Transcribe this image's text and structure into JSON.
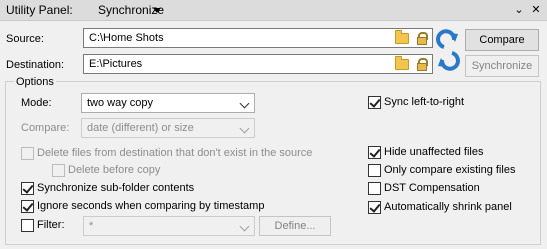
{
  "titlebar": {
    "title": "Utility Panel:",
    "selected_view": "Synchronize",
    "collapse_label": "⌄",
    "close_label": "✕"
  },
  "source": {
    "label": "Source:",
    "value": "C:\\Home Shots"
  },
  "destination": {
    "label": "Destination:",
    "value": "E:\\Pictures"
  },
  "buttons": {
    "compare": "Compare",
    "synchronize": "Synchronize",
    "define": "Define..."
  },
  "options": {
    "group_title": "Options",
    "mode": {
      "label": "Mode:",
      "value": "two way copy"
    },
    "compare": {
      "label": "Compare:",
      "value": "date (different) or size"
    },
    "delete_files": {
      "label": "Delete files from destination that don't exist in the source",
      "checked": false
    },
    "delete_before_copy": {
      "label": "Delete before copy",
      "checked": false
    },
    "sync_subfolders": {
      "label": "Synchronize sub-folder contents",
      "checked": true
    },
    "ignore_seconds": {
      "label": "Ignore seconds when comparing by timestamp",
      "checked": true
    },
    "filter": {
      "label": "Filter:",
      "value": "*",
      "checked": false
    },
    "sync_left_to_right": {
      "label": "Sync left-to-right",
      "checked": true
    },
    "hide_unaffected": {
      "label": "Hide unaffected files",
      "checked": true
    },
    "only_compare_existing": {
      "label": "Only compare existing files",
      "checked": false
    },
    "dst_compensation": {
      "label": "DST Compensation",
      "checked": false
    },
    "auto_shrink": {
      "label": "Automatically shrink panel",
      "checked": true
    }
  },
  "colors": {
    "swap_arrow": "#2a78c8",
    "folder": "#f3c54f"
  }
}
